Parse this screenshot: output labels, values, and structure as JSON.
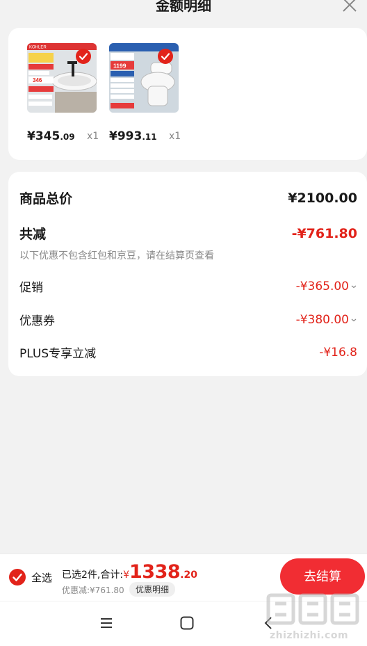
{
  "header": {
    "title": "金额明细",
    "close_icon": "close-icon"
  },
  "products": [
    {
      "price_main": "¥345",
      "price_cents": ".09",
      "qty": "x1",
      "selected": true,
      "thumb_texts": [
        "KOHLER",
        "346"
      ]
    },
    {
      "price_main": "¥993",
      "price_cents": ".11",
      "qty": "x1",
      "selected": true,
      "thumb_texts": [
        "1199"
      ]
    }
  ],
  "summary": {
    "total_label": "商品总价",
    "total_value": "¥2100.00",
    "reduce_label": "共减",
    "reduce_value": "-¥761.80",
    "note": "以下优惠不包含红包和京豆，请在结算页查看",
    "promo_label": "促销",
    "promo_value": "-¥365.00",
    "coupon_label": "优惠券",
    "coupon_value": "-¥380.00",
    "plus_label": "PLUS专享立减",
    "plus_value": "-¥16.8"
  },
  "footer": {
    "select_all": "全选",
    "selected_text": "已选2件,合计:",
    "currency": "¥",
    "total_int": "1338",
    "total_dec": ".20",
    "discount_text": "优惠减:¥761.80",
    "detail_chip": "优惠明细",
    "checkout": "去结算"
  },
  "navbar": {
    "icons": [
      "menu-icon",
      "home-icon",
      "back-icon"
    ]
  },
  "watermark": {
    "text": "zhizhizhi.com"
  },
  "colors": {
    "accent": "#e2231a",
    "button": "#f12d33",
    "background": "#f2f2f2"
  }
}
